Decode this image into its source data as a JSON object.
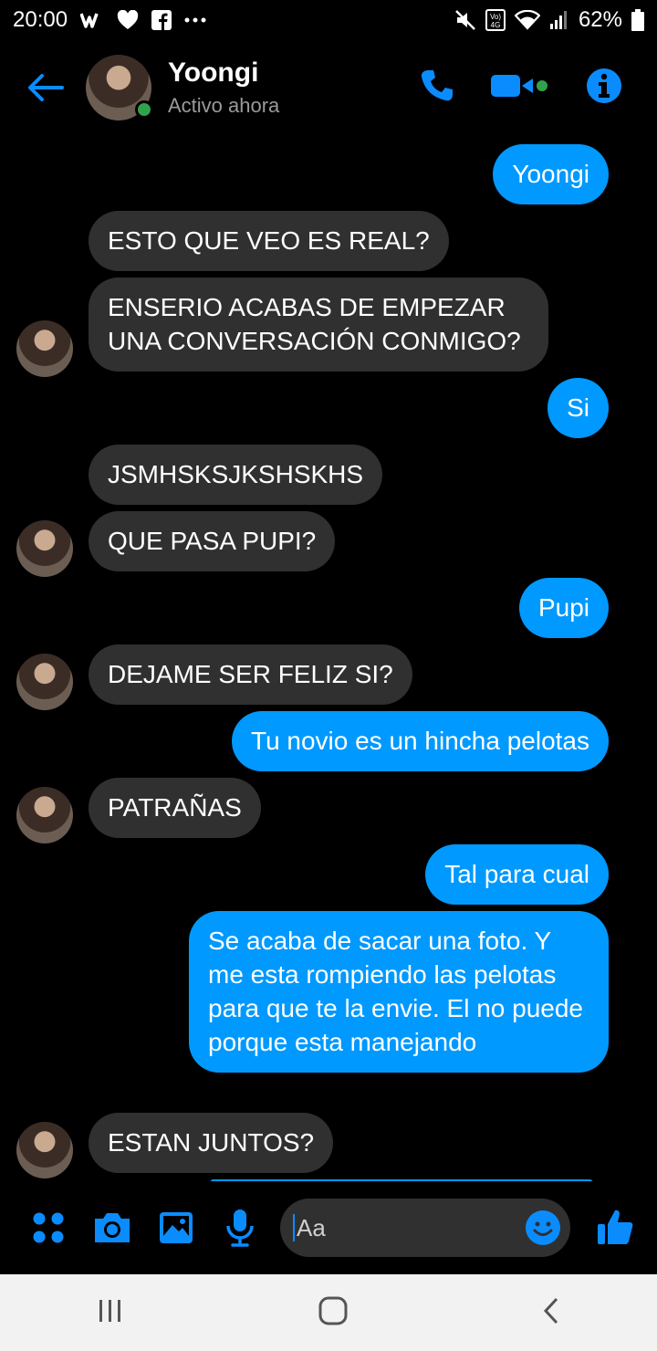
{
  "status_bar": {
    "time": "20:00",
    "left_icons": [
      "wattpad-icon",
      "heart-icon",
      "facebook-icon",
      "more-icon"
    ],
    "right_icons": [
      "mute-icon",
      "volte-icon",
      "wifi-icon",
      "signal-icon",
      "battery-icon"
    ],
    "volte_label": "Vo) 4G",
    "battery": "62%"
  },
  "header": {
    "name": "Yoongi",
    "status": "Activo ahora",
    "accent": "#0a8cff",
    "online_color": "#31a24c"
  },
  "messages": [
    {
      "dir": "out",
      "text": "Yoongi"
    },
    {
      "dir": "in",
      "text": "ESTO QUE VEO ES REAL?"
    },
    {
      "dir": "in",
      "text": "ENSERIO ACABAS DE EMPEZAR UNA CONVERSACIÓN CONMIGO?"
    },
    {
      "dir": "out",
      "text": "Si"
    },
    {
      "dir": "in",
      "text": "JSMHSKSJKSHSKHS"
    },
    {
      "dir": "in",
      "text": "QUE PASA PUPI?"
    },
    {
      "dir": "out",
      "text": "Pupi"
    },
    {
      "dir": "in",
      "text": "DEJAME SER FELIZ SI?"
    },
    {
      "dir": "out",
      "text": "Tu novio es un hincha pelotas"
    },
    {
      "dir": "in",
      "text": "PATRAÑAS"
    },
    {
      "dir": "out",
      "text": "Tal para cual"
    },
    {
      "dir": "out",
      "text": "Se acaba de sacar una foto. Y me esta rompiendo las pelotas para que te la envie. El no puede porque esta manejando"
    },
    {
      "dir": "in",
      "text": "ESTAN JUNTOS?"
    }
  ],
  "composer": {
    "placeholder": "Aa",
    "icons": [
      "menu-dots-icon",
      "camera-icon",
      "gallery-icon",
      "microphone-icon",
      "emoji-icon",
      "thumbs-up-icon"
    ]
  },
  "colors": {
    "outgoing_bubble": "#0099ff",
    "incoming_bubble": "#303030",
    "background": "#000000"
  }
}
